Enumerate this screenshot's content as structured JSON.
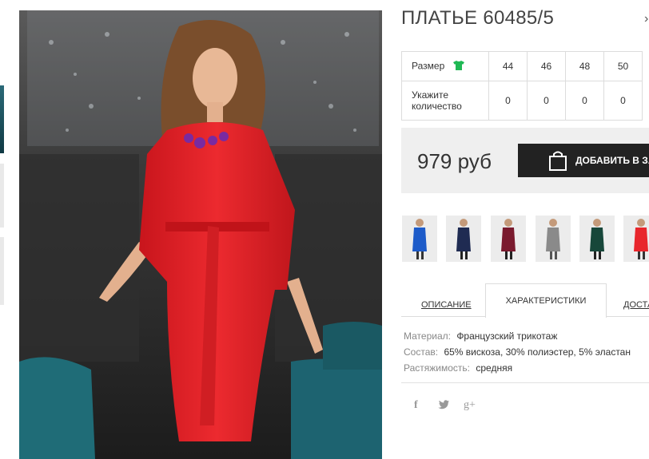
{
  "product": {
    "title": "ПЛАТЬЕ 60485/5",
    "photo_alt": "Красное платье"
  },
  "size_table": {
    "size_label": "Размер",
    "qty_label": "Укажите количество",
    "sizes": [
      "44",
      "46",
      "48",
      "50"
    ],
    "quantities": [
      "0",
      "0",
      "0",
      "0"
    ]
  },
  "purchase": {
    "price": "979 руб",
    "add_button": "ДОБАВИТЬ В ЗАКАЗ"
  },
  "variants": [
    "blue",
    "navy",
    "burgundy",
    "grey",
    "green",
    "red"
  ],
  "tabs": [
    "ОПИСАНИЕ",
    "ХАРАКТЕРИСТИКИ",
    "ДОСТАВКА"
  ],
  "specs": [
    {
      "key": "Материал:",
      "value": "Французский трикотаж"
    },
    {
      "key": "Состав:",
      "value": "65% вискоза, 30% полиэстер, 5% эластан"
    },
    {
      "key": "Растяжимость:",
      "value": "средняя"
    }
  ],
  "social": {
    "facebook": "f",
    "twitter": "twitter-icon",
    "google": "g+"
  },
  "colors": {
    "accent_green": "#1fb854",
    "dress_red": "#e8262c",
    "button_dark": "#222222"
  }
}
